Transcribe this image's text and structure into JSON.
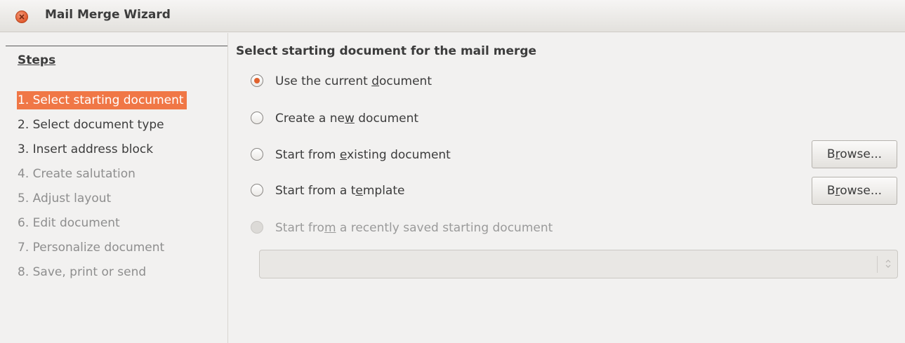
{
  "window": {
    "title": "Mail Merge Wizard"
  },
  "steps": {
    "heading": "Steps",
    "items": [
      {
        "label": "1. Select starting document",
        "state": "active"
      },
      {
        "label": "2. Select document type",
        "state": "enabled"
      },
      {
        "label": "3. Insert address block",
        "state": "enabled"
      },
      {
        "label": "4. Create salutation",
        "state": "disabled"
      },
      {
        "label": "5. Adjust layout",
        "state": "disabled"
      },
      {
        "label": "6. Edit document",
        "state": "disabled"
      },
      {
        "label": "7. Personalize document",
        "state": "disabled"
      },
      {
        "label": "8. Save, print or send",
        "state": "disabled"
      }
    ]
  },
  "main": {
    "title": "Select starting document for the mail merge",
    "options": [
      {
        "before": "Use the current ",
        "mnemonic": "d",
        "after": "ocument",
        "checked": true,
        "enabled": true
      },
      {
        "before": "Create a ne",
        "mnemonic": "w",
        "after": " document",
        "checked": false,
        "enabled": true
      },
      {
        "before": "Start from ",
        "mnemonic": "e",
        "after": "xisting document",
        "checked": false,
        "enabled": true
      },
      {
        "before": "Start from a t",
        "mnemonic": "e",
        "after": "mplate",
        "checked": false,
        "enabled": true
      },
      {
        "before": "Start fro",
        "mnemonic": "m",
        "after": " a recently saved starting document",
        "checked": false,
        "enabled": false
      }
    ],
    "browse_existing": {
      "before": "B",
      "mnemonic": "r",
      "after": "owse..."
    },
    "browse_template": {
      "before": "B",
      "mnemonic": "r",
      "after": "owse..."
    },
    "recent_select": {
      "value": ""
    }
  },
  "colors": {
    "accent": "#f07746",
    "radio_dot": "#e0612d",
    "close": "#e05a2e"
  }
}
